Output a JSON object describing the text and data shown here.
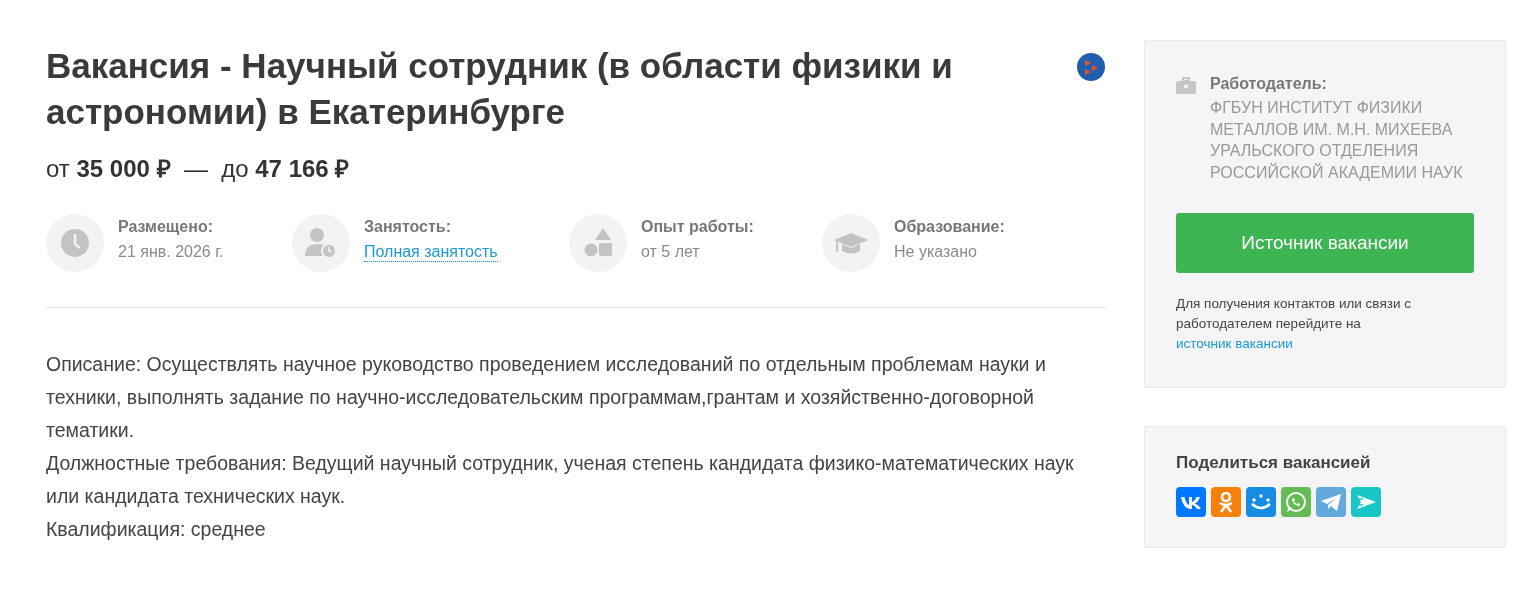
{
  "title": "Вакансия - Научный сотрудник (в области физики и астрономии) в Екатеринбурге",
  "salary": "от **35 000 ₽**  —  до **47 166 ₽**",
  "facts": [
    {
      "kind": "date",
      "label": "Размещено:",
      "value": "21 янв. 2026 г.",
      "link": false
    },
    {
      "kind": "employment",
      "label": "Занятость:",
      "value": "Полная занятость",
      "link": true
    },
    {
      "kind": "experience",
      "label": "Опыт работы:",
      "value": "от 5 лет",
      "link": false
    },
    {
      "kind": "education",
      "label": "Образование:",
      "value": "Не указано",
      "link": false
    }
  ],
  "description": [
    "Описание: Осуществлять научное руководство проведением исследований по отдельным проблемам науки и техники, выполнять задание по научно-исследовательским программам,грантам и хозяйственно-договорной тематики.",
    "Должностные требования: Ведущий научный сотрудник, ученая степень кандидата физико-математических наук или кандидата технических наук.",
    "Квалификация: среднее"
  ],
  "employer": {
    "label": "Работодатель:",
    "name": "ФГБУН ИНСТИТУТ ФИЗИКИ МЕТАЛЛОВ ИМ. М.Н. МИХЕЕВА УРАЛЬСКОГО ОТДЕЛЕНИЯ РОССИЙСКОЙ АКАДЕМИИ НАУК",
    "button": "Источник вакансии",
    "note": "Для получения контактов или связи с работодателем перейдите на",
    "note_link": "источник вакансии"
  },
  "share": {
    "title": "Поделиться вакансией",
    "buttons": [
      {
        "kind": "vk"
      },
      {
        "kind": "ok"
      },
      {
        "kind": "mailru"
      },
      {
        "kind": "whatsapp"
      },
      {
        "kind": "telegram"
      },
      {
        "kind": "send"
      }
    ]
  }
}
